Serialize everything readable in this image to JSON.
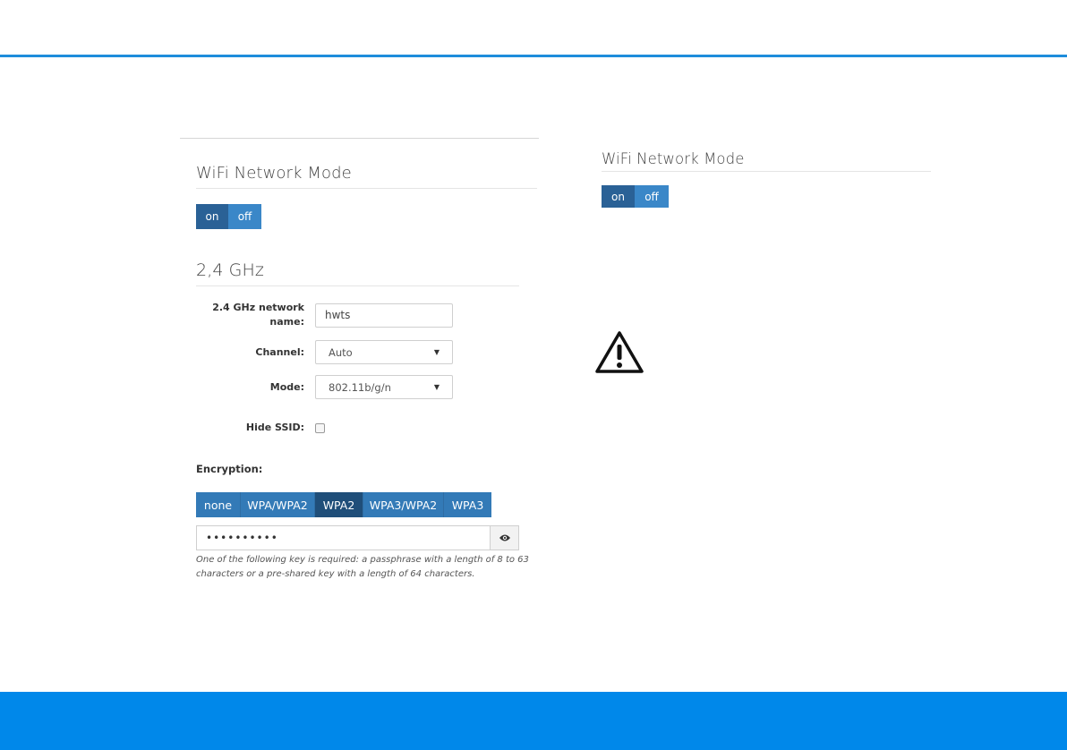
{
  "left_panel": {
    "wifi_mode": {
      "heading": "WiFi Network Mode",
      "on_label": "on",
      "off_label": "off",
      "selected": "on"
    },
    "band": {
      "heading": "2,4 GHz",
      "network_name_label": "2.4 GHz network name:",
      "network_name_value": "hwts",
      "channel_label": "Channel:",
      "channel_value": "Auto",
      "mode_label": "Mode:",
      "mode_value": "802.11b/g/n",
      "hide_ssid_label": "Hide SSID:",
      "hide_ssid_checked": false
    },
    "encryption": {
      "label": "Encryption:",
      "options": [
        "none",
        "WPA/WPA2",
        "WPA2",
        "WPA3/WPA2",
        "WPA3"
      ],
      "selected": "WPA2",
      "key_masked": "••••••••••",
      "help_line1": "One of the following key is required: a passphrase with a length of 8 to 63",
      "help_line2": "characters or a pre-shared key with a length of 64 characters."
    }
  },
  "right_panel": {
    "wifi_mode": {
      "heading": "WiFi Network Mode",
      "on_label": "on",
      "off_label": "off",
      "selected": "on"
    },
    "warning_icon": "warning-triangle-icon"
  },
  "colors": {
    "accent_blue": "#1e8ddb",
    "footer_blue": "#0088ea",
    "button_blue": "#337ab7",
    "button_active": "#1f4e79"
  }
}
